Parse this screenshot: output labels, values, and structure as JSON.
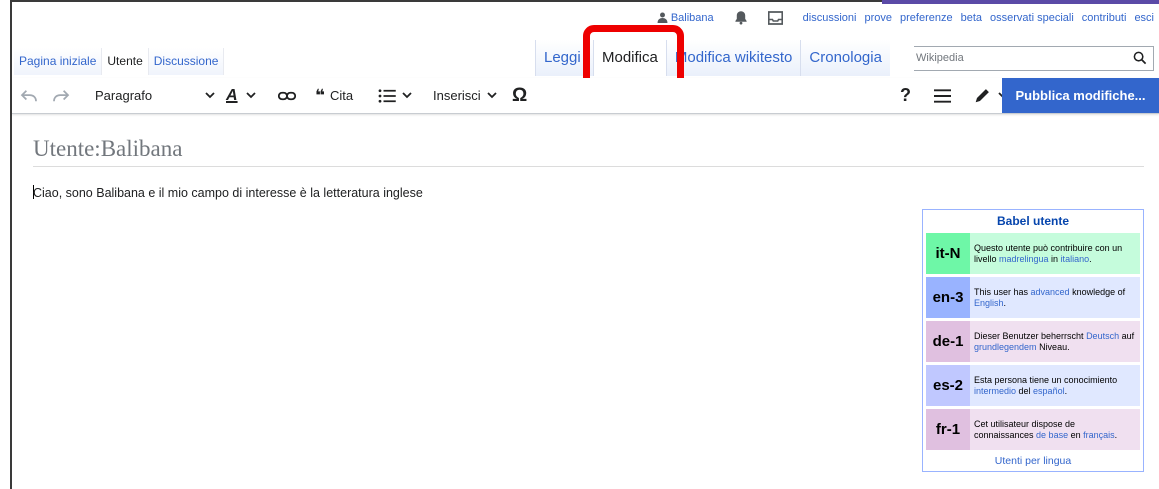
{
  "personal": {
    "username": "Balibana",
    "links": [
      "discussioni",
      "prove",
      "preferenze",
      "beta",
      "osservati speciali",
      "contributi",
      "esci"
    ]
  },
  "tabs_left": [
    {
      "label": "Pagina iniziale",
      "selected": false
    },
    {
      "label": "Utente",
      "selected": true
    },
    {
      "label": "Discussione",
      "selected": false
    }
  ],
  "tabs_right": [
    {
      "label": "Leggi",
      "active": false
    },
    {
      "label": "Modifica",
      "active": true
    },
    {
      "label": "Modifica wikitesto",
      "active": false
    },
    {
      "label": "Cronologia",
      "active": false
    }
  ],
  "search": {
    "placeholder": "Wikipedia"
  },
  "toolbar": {
    "paragraph": "Paragrafo",
    "cite": "Cita",
    "insert": "Inserisci",
    "help": "?",
    "publish": "Pubblica modifiche..."
  },
  "page": {
    "title": "Utente:Balibana",
    "text": "Ciao, sono Balibana e il mio campo di interesse è la letteratura inglese"
  },
  "babel": {
    "title": "Babel utente",
    "rows": [
      {
        "code": "it-N",
        "code_bg": "#6ef7a7",
        "text_bg": "#c5fcdc",
        "parts": [
          "Questo utente può contribuire con un livello ",
          "madrelingua",
          " in ",
          "italiano",
          "."
        ]
      },
      {
        "code": "en-3",
        "code_bg": "#99b3ff",
        "text_bg": "#e0e8ff",
        "parts": [
          "This user has ",
          "advanced",
          " knowledge of ",
          "English",
          "."
        ]
      },
      {
        "code": "de-1",
        "code_bg": "#e0c0e0",
        "text_bg": "#f0e0f0",
        "parts": [
          "Dieser Benutzer beherrscht ",
          "Deutsch",
          " auf ",
          "grundlegendem",
          " Niveau."
        ]
      },
      {
        "code": "es-2",
        "code_bg": "#c0c8ff",
        "text_bg": "#e0e8ff",
        "parts": [
          "Esta persona tiene un conocimiento ",
          "intermedio",
          " del ",
          "español",
          "."
        ]
      },
      {
        "code": "fr-1",
        "code_bg": "#e0c0e0",
        "text_bg": "#f0e0f0",
        "parts": [
          "Cet utilisateur dispose de connaissances ",
          "de base",
          " en ",
          "français",
          "."
        ]
      }
    ],
    "footer": "Utenti per lingua"
  }
}
